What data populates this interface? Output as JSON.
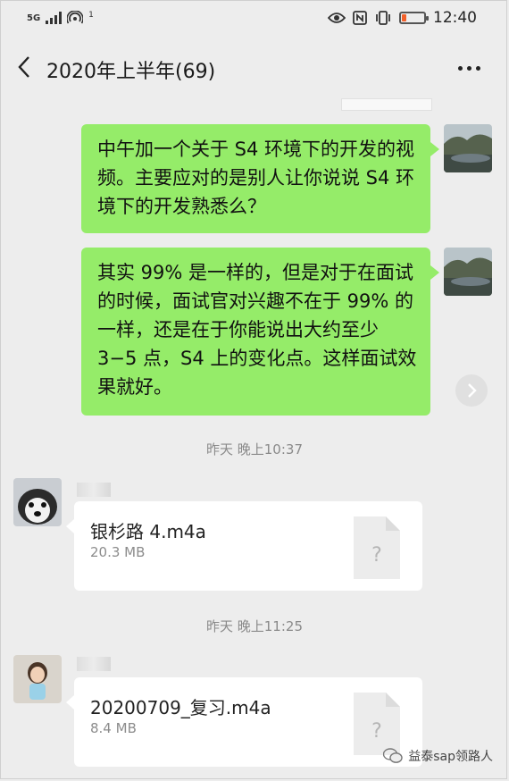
{
  "status_bar": {
    "network": "5G",
    "signal_note": "1",
    "time": "12:40",
    "battery_level": 0.2,
    "battery_color": "#f2602a"
  },
  "title_bar": {
    "title": "2020年上半年(69)",
    "back_icon": "chevron-left-icon",
    "more_icon": "more-dots-icon"
  },
  "messages": {
    "out_1": "中午加一个关于 S4 环境下的开发的视频。主要应对的是别人让你说说 S4 环境下的开发熟悉么？",
    "out_2": "其实 99% 是一样的，但是对于在面试的时候，面试官对兴趣不在于 99% 的一样，还是在于你能说出大约至少 3−5 点，S4 上的变化点。这样面试效果就好。",
    "time_1": "昨天 晚上10:37",
    "file_1_name": "银杉路 4.m4a",
    "file_1_size": "20.3 MB",
    "time_2": "昨天 晚上11:25",
    "file_2_name": "20200709_复习.m4a",
    "file_2_size": "8.4 MB",
    "file_icon_mark": "?"
  },
  "watermark": {
    "text": "益泰sap领路人"
  },
  "colors": {
    "bubble_out": "#95ec69",
    "background": "#ededed",
    "card": "#ffffff"
  }
}
